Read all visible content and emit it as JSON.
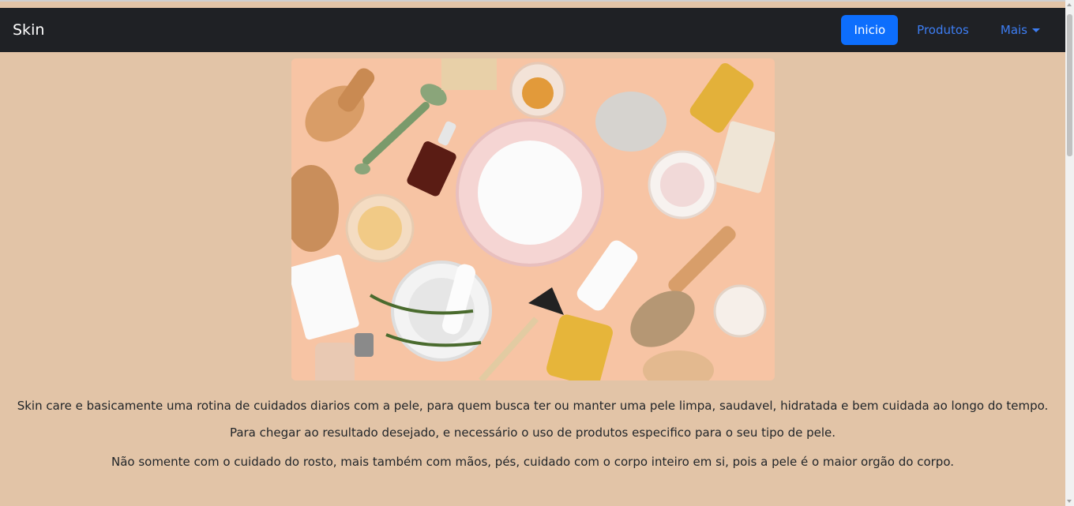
{
  "navbar": {
    "brand": "Skin",
    "items": [
      {
        "label": "Inicio",
        "active": true
      },
      {
        "label": "Produtos",
        "active": false
      },
      {
        "label": "Mais",
        "active": false,
        "dropdown": true
      }
    ]
  },
  "hero": {
    "description": "Skin care products flat-lay on peach background"
  },
  "content": {
    "paragraphs": [
      "Skin care e basicamente uma rotina de cuidados diarios com a pele, para quem busca ter ou manter uma pele limpa, saudavel, hidratada e bem cuidada ao longo do tempo.",
      "Para chegar ao resultado desejado, e necessário o uso de produtos especifico para o seu tipo de pele.",
      "Não somente com o cuidado do rosto, mais também com mãos, pés, cuidado com o corpo inteiro em si, pois a pele é o maior orgão do corpo."
    ]
  },
  "colors": {
    "page_bg": "#e2c4a7",
    "navbar_bg": "#1f2125",
    "accent": "#0d6efd",
    "link": "#3d7ef4"
  }
}
